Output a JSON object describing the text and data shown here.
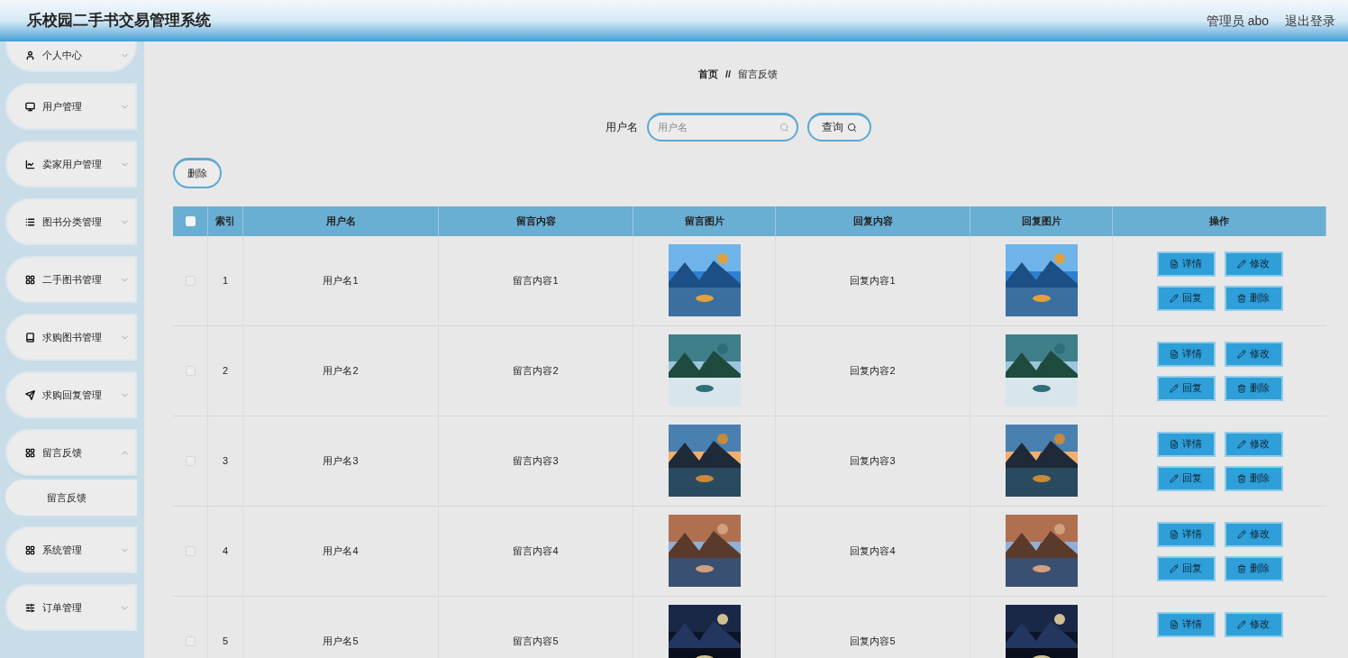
{
  "header": {
    "title": "乐校园二手书交易管理系统",
    "user": "管理员 abo",
    "logout": "退出登录"
  },
  "sidebar": {
    "items": [
      {
        "label": "个人中心",
        "expanded": false
      },
      {
        "label": "用户管理",
        "expanded": false
      },
      {
        "label": "卖家用户管理",
        "expanded": false
      },
      {
        "label": "图书分类管理",
        "expanded": false
      },
      {
        "label": "二手图书管理",
        "expanded": false
      },
      {
        "label": "求购图书管理",
        "expanded": false
      },
      {
        "label": "求购回复管理",
        "expanded": false
      },
      {
        "label": "留言反馈",
        "expanded": true,
        "children": [
          {
            "label": "留言反馈",
            "selected": true
          }
        ]
      },
      {
        "label": "系统管理",
        "expanded": false
      },
      {
        "label": "订单管理",
        "expanded": false
      }
    ]
  },
  "breadcrumb": [
    "首页",
    "//",
    "留言反馈"
  ],
  "search": {
    "label": "用户名",
    "placeholder": "用户名",
    "button": "查询"
  },
  "delete_button": "删除",
  "table": {
    "columns": [
      "索引",
      "用户名",
      "留言内容",
      "留言图片",
      "回复内容",
      "回复图片",
      "操作"
    ],
    "all_checked": false,
    "rows": [
      {
        "checked": false,
        "index": "1",
        "username": "用户名1",
        "message": "留言内容1",
        "reply": "回复内容1",
        "actions": [
          "详情",
          "修改",
          "回复",
          "删除"
        ]
      },
      {
        "checked": false,
        "index": "2",
        "username": "用户名2",
        "message": "留言内容2",
        "reply": "回复内容2",
        "actions": [
          "详情",
          "修改",
          "回复",
          "删除"
        ]
      },
      {
        "checked": false,
        "index": "3",
        "username": "用户名3",
        "message": "留言内容3",
        "reply": "回复内容3",
        "actions": [
          "详情",
          "修改",
          "回复",
          "删除"
        ]
      },
      {
        "checked": false,
        "index": "4",
        "username": "用户名4",
        "message": "留言内容4",
        "reply": "回复内容4",
        "actions": [
          "详情",
          "修改",
          "回复",
          "删除"
        ]
      },
      {
        "checked": false,
        "index": "5",
        "username": "用户名5",
        "message": "留言内容5",
        "reply": "回复内容5",
        "actions": [
          "详情",
          "修改"
        ]
      }
    ]
  }
}
